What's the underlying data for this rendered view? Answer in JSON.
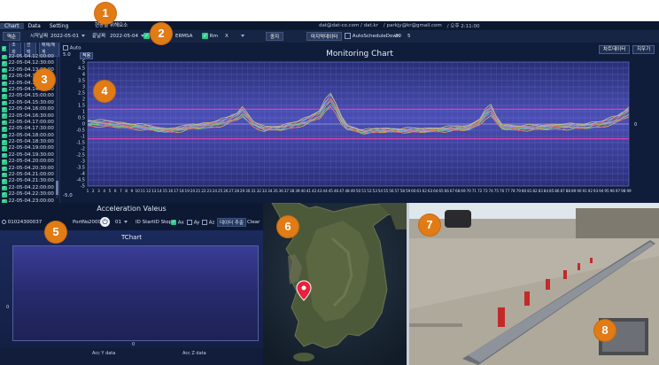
{
  "menubar": {
    "items": [
      "Chart",
      "Data",
      "Setting"
    ],
    "info": [
      "dat@dat-co.com / dat.kr",
      "/ parkjy@kr@gmail.com",
      "/ 오후 2:11:00"
    ]
  },
  "toolbar": {
    "mode_label": "역순",
    "start_label": "시작날짜",
    "start_date": "2022-05-01",
    "realtime_label": "현장별 위해요소",
    "end_label": "끝날짜",
    "end_date": "2022-05-04",
    "rms_label": "ERMSA",
    "rms_val_label": "Rm",
    "axis_value": "X",
    "stop_button": "중지",
    "data_button": "마지막데이터",
    "autoschedule_label": "AutoScheduleDown",
    "auto_val1": "30",
    "auto_val2": "5"
  },
  "sidebar": {
    "btn_lookup": "조회",
    "btn_select": "선택",
    "btn_deselect": "해제/체계",
    "items": [
      "22-05-04.12:00:00",
      "22-05-04.12:30:00",
      "22-05-04.13:00:00",
      "22-05-04.13:30:00",
      "22-05-04.14:00:00",
      "22-05-04.14:30:00",
      "22-05-04.15:00:00",
      "22-05-04.15:30:00",
      "22-05-04.16:00:00",
      "22-05-04.16:30:00",
      "22-05-04.17:00:00",
      "22-05-04.17:30:00",
      "22-05-04.18:00:00",
      "22-05-04.18:30:00",
      "22-05-04.19:00:00",
      "22-05-04.19:30:00",
      "22-05-04.20:00:00",
      "22-05-04.20:30:00",
      "22-05-04.21:00:00",
      "22-05-04.21:30:00",
      "22-05-04.22:00:00",
      "22-05-04.22:30:00",
      "22-05-04.23:00:00",
      "22-05-04.23:30:00"
    ]
  },
  "monitoring": {
    "title": "Monitoring Chart",
    "auto_label": "Auto",
    "max_value": "5.0",
    "min_value": "-5.0",
    "apply_label": "적용",
    "btn_chart_data": "차트데이터",
    "btn_clear": "지우기",
    "right_zero": "0"
  },
  "chart_data": {
    "type": "line",
    "title": "Monitoring Chart",
    "xlabel": "",
    "ylabel": "",
    "ylim": [
      -5,
      5
    ],
    "yticks": [
      "5",
      "4.5",
      "4",
      "3.5",
      "3",
      "2.5",
      "2",
      "1.5",
      "1",
      "0.5",
      "0",
      "-0.5",
      "-1",
      "-1.5",
      "-2",
      "-2.5",
      "-3",
      "-3.5",
      "-4",
      "-4.5",
      "-5"
    ],
    "x_range": [
      1,
      99
    ],
    "threshold_upper": 1.2,
    "threshold_lower": -1.2,
    "grid": true,
    "series_colors": [
      "#f0c040",
      "#e05090",
      "#40c0e0",
      "#80e060",
      "#f08040",
      "#c080f0",
      "#60d0b0",
      "#f06060",
      "#a0b0ff",
      "#d0d060"
    ],
    "base_profile": [
      [
        1,
        0.1
      ],
      [
        5,
        0.0
      ],
      [
        10,
        -0.2
      ],
      [
        15,
        -0.5
      ],
      [
        18,
        -0.4
      ],
      [
        20,
        -0.2
      ],
      [
        23,
        -0.1
      ],
      [
        26,
        0.2
      ],
      [
        28,
        0.6
      ],
      [
        29,
        1.0
      ],
      [
        30,
        0.5
      ],
      [
        31,
        0.0
      ],
      [
        33,
        -0.4
      ],
      [
        36,
        -0.3
      ],
      [
        39,
        0.0
      ],
      [
        41,
        0.3
      ],
      [
        43,
        0.8
      ],
      [
        44,
        1.5
      ],
      [
        45,
        1.9
      ],
      [
        46,
        1.2
      ],
      [
        47,
        0.3
      ],
      [
        48,
        -0.3
      ],
      [
        51,
        -0.6
      ],
      [
        54,
        -0.5
      ],
      [
        58,
        -0.5
      ],
      [
        62,
        -0.5
      ],
      [
        66,
        -0.4
      ],
      [
        70,
        -0.3
      ],
      [
        72,
        0.2
      ],
      [
        73,
        0.8
      ],
      [
        74,
        1.1
      ],
      [
        75,
        0.3
      ],
      [
        76,
        -0.2
      ],
      [
        78,
        -0.3
      ],
      [
        82,
        -0.3
      ],
      [
        86,
        -0.2
      ],
      [
        90,
        -0.2
      ],
      [
        94,
        0.0
      ],
      [
        97,
        0.4
      ],
      [
        99,
        1.0
      ]
    ]
  },
  "acceleration": {
    "title": "Acceleration Valeus",
    "device_id": "01024300037",
    "port_label": "PortNo",
    "port_value": "20000",
    "channel": "01",
    "start_label": "ID Start",
    "stop_label": "ID Stop",
    "ax_label": "Ax",
    "ay_label": "Ay",
    "az_label": "Az",
    "extract_label": "데이터 추출",
    "clear_label": "Clear",
    "tchart_title": "TChart",
    "tchart_y_zero": "0",
    "tchart_x_zero": "0",
    "footer_y": "Acc Y data",
    "footer_z": "Acc Z data"
  },
  "badges": [
    "1",
    "2",
    "3",
    "4",
    "5",
    "6",
    "7",
    "8"
  ],
  "colors": {
    "accent": "#e07b16",
    "threshold": "#ff40b0",
    "panel_bg": "#0f1c3a"
  }
}
